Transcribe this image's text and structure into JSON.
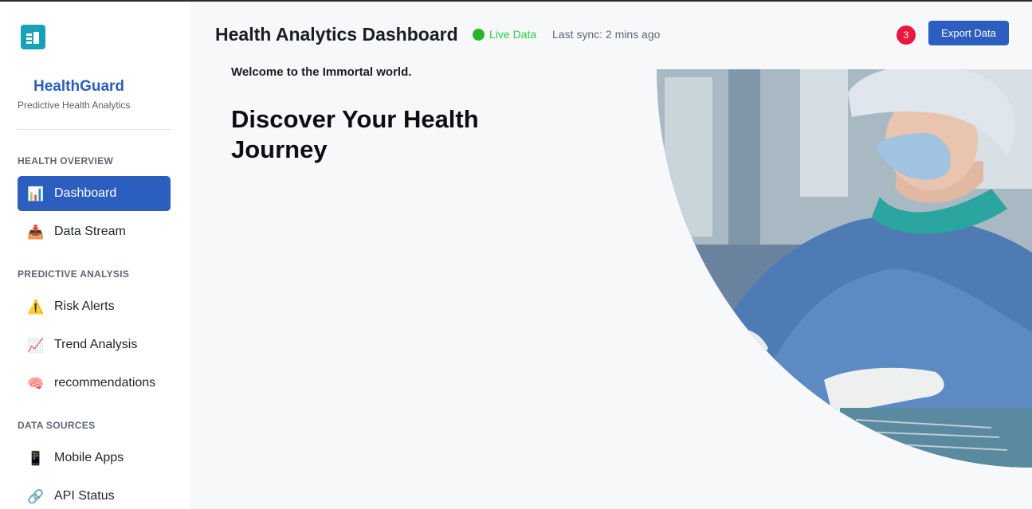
{
  "sidebar": {
    "brand": {
      "name": "HealthGuard",
      "tagline": "Predictive Health Analytics"
    },
    "sections": [
      {
        "title": "HEALTH OVERVIEW",
        "items": [
          {
            "icon": "📊",
            "icon_name": "bar-chart-icon",
            "label": "Dashboard",
            "active": true
          },
          {
            "icon": "📥",
            "icon_name": "inbox-tray-icon",
            "label": "Data Stream",
            "active": false
          }
        ]
      },
      {
        "title": "PREDICTIVE ANALYSIS",
        "items": [
          {
            "icon": "⚠️",
            "icon_name": "warning-icon",
            "label": "Risk Alerts",
            "active": false
          },
          {
            "icon": "📈",
            "icon_name": "trend-chart-icon",
            "label": "Trend Analysis",
            "active": false
          },
          {
            "icon": "🧠",
            "icon_name": "brain-icon",
            "label": "recommendations",
            "active": false
          }
        ]
      },
      {
        "title": "DATA SOURCES",
        "items": [
          {
            "icon": "📱",
            "icon_name": "mobile-phone-icon",
            "label": "Mobile Apps",
            "active": false
          },
          {
            "icon": "🔗",
            "icon_name": "link-icon",
            "label": "API Status",
            "active": false
          }
        ]
      }
    ]
  },
  "header": {
    "title": "Health Analytics Dashboard",
    "live_label": "Live Data",
    "sync_text": "Last sync: 2 mins ago",
    "notification_count": "3",
    "export_label": "Export Data"
  },
  "main": {
    "welcome": "Welcome to the Immortal world.",
    "hero_title": "Discover Your Health Journey"
  },
  "colors": {
    "accent": "#2c5ebf",
    "logo": "#17a2b8",
    "live": "#2ecc40",
    "badge": "#e8173d"
  }
}
